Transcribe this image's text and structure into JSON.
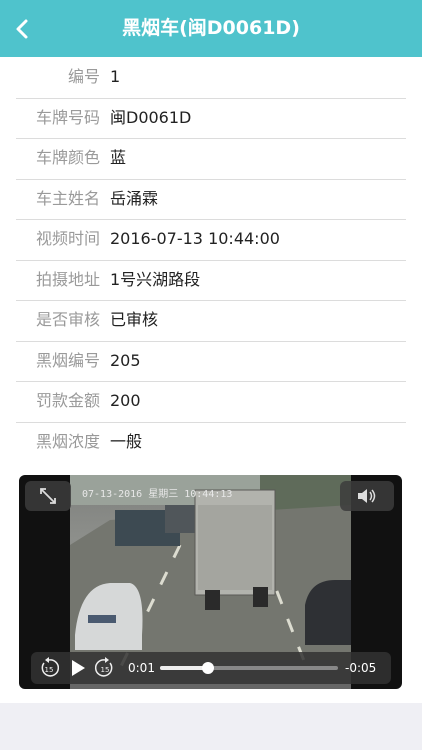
{
  "header": {
    "title": "黑烟车(闽D0061D)"
  },
  "details": [
    {
      "label": "编号",
      "value": "1"
    },
    {
      "label": "车牌号码",
      "value": "闽D0061D"
    },
    {
      "label": "车牌颜色",
      "value": "蓝"
    },
    {
      "label": "车主姓名",
      "value": "岳涌霖"
    },
    {
      "label": "视频时间",
      "value": "2016-07-13 10:44:00"
    },
    {
      "label": "拍摄地址",
      "value": "1号兴湖路段"
    },
    {
      "label": "是否审核",
      "value": "已审核"
    },
    {
      "label": "黑烟编号",
      "value": "205"
    },
    {
      "label": "罚款金额",
      "value": "200"
    },
    {
      "label": "黑烟浓度",
      "value": "一般"
    }
  ],
  "video": {
    "overlay_text": "07-13-2016 星期三 10:44:13",
    "elapsed": "0:01",
    "remaining": "-0:05",
    "progress": 0.27,
    "skip_back": "15",
    "skip_forward": "15"
  }
}
